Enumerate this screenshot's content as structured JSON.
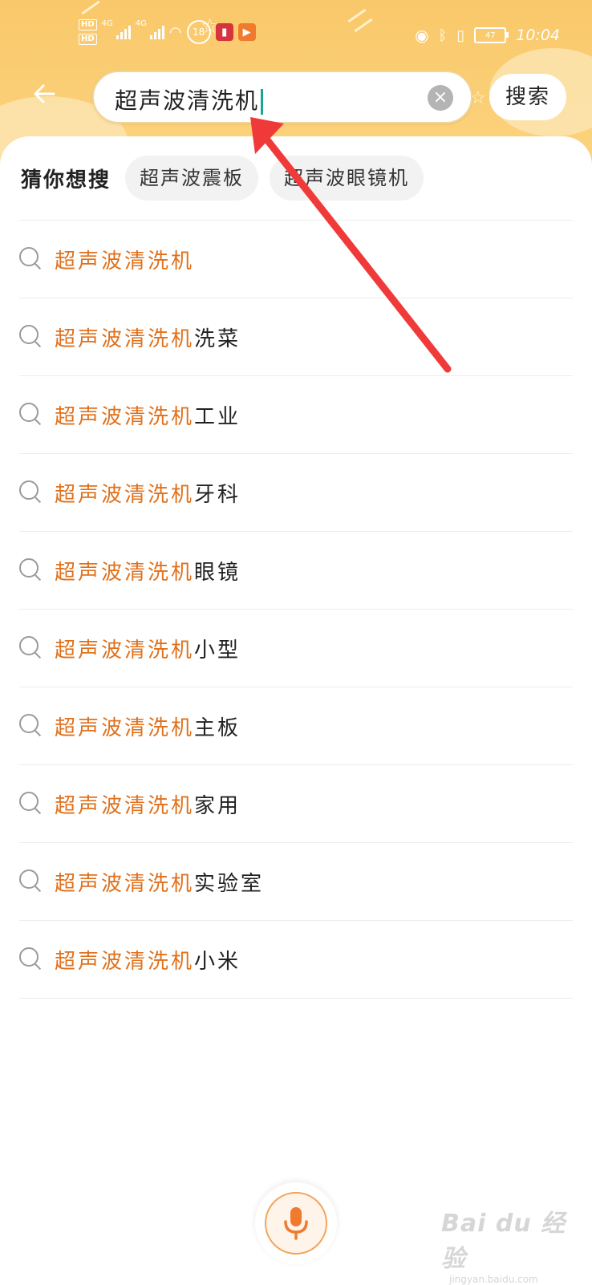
{
  "status_bar": {
    "hd1": "HD",
    "hd2": "HD",
    "net1": "4G",
    "net2": "4G",
    "badge": "18",
    "battery": "47",
    "time": "10:04"
  },
  "search": {
    "query": "超声波清洗机",
    "button_label": "搜索"
  },
  "suggestions": {
    "title": "猜你想搜",
    "chips": [
      "超声波震板",
      "超声波眼镜机"
    ]
  },
  "results": {
    "highlight": "超声波清洗机",
    "items": [
      {
        "suffix": ""
      },
      {
        "suffix": "洗菜"
      },
      {
        "suffix": "工业"
      },
      {
        "suffix": "牙科"
      },
      {
        "suffix": "眼镜"
      },
      {
        "suffix": "小型"
      },
      {
        "suffix": "主板"
      },
      {
        "suffix": "家用"
      },
      {
        "suffix": "实验室"
      },
      {
        "suffix": "小米"
      }
    ]
  },
  "watermark": {
    "main": "Bai du 经验",
    "sub": "jingyan.baidu.com"
  },
  "icons": {
    "back": "back-arrow-icon",
    "clear": "clear-icon",
    "mic": "microphone-icon",
    "result": "search-icon"
  },
  "colors": {
    "header": "#f9c86a",
    "highlight": "#e0711c",
    "annotation": "#f03a3a",
    "mic": "#f07a2e"
  }
}
